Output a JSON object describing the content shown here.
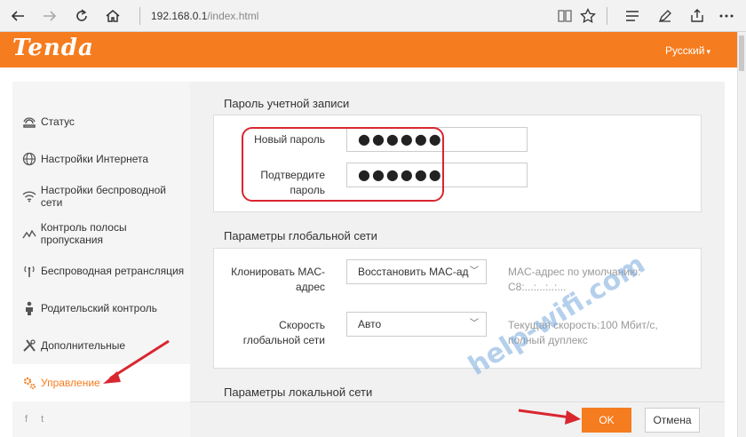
{
  "browser": {
    "address_host": "192.168.0.1",
    "address_path": "/index.html"
  },
  "header": {
    "logo": "Tenda",
    "language": "Русский"
  },
  "sidebar": {
    "items": [
      {
        "label": "Статус",
        "icon": "status-icon"
      },
      {
        "label": "Настройки Интернета",
        "icon": "globe-icon"
      },
      {
        "label": "Настройки беспроводной сети",
        "icon": "wifi-icon"
      },
      {
        "label": "Контроль полосы пропускания",
        "icon": "bandwidth-icon"
      },
      {
        "label": "Беспроводная ретрансляция",
        "icon": "antenna-icon"
      },
      {
        "label": "Родительский контроль",
        "icon": "parent-icon"
      },
      {
        "label": "Дополнительные",
        "icon": "tools-icon"
      },
      {
        "label": "Управление",
        "icon": "gears-icon",
        "active": true
      }
    ],
    "social": "f  t"
  },
  "account_password": {
    "title": "Пароль учетной записи",
    "new_password_label": "Новый пароль",
    "new_password_value": "●●●●●●",
    "confirm_label_line1": "Подтвердите",
    "confirm_label_line2": "пароль",
    "confirm_value": "●●●●●●"
  },
  "wan": {
    "title": "Параметры глобальной сети",
    "clone_label_line1": "Клонировать MAC-",
    "clone_label_line2": "адрес",
    "clone_value": "Восстановить MAC-ад",
    "clone_hint_line1": "MAC-адрес по умолчанию:",
    "clone_hint_line2": "C8:...:...:..:...",
    "speed_label_line1": "Скорость",
    "speed_label_line2": "глобальной сети",
    "speed_value": "Авто",
    "speed_hint_line1": "Текущая скорость:100 Мбит/с,",
    "speed_hint_line2": "полный дуплекс"
  },
  "lan": {
    "title": "Параметры локальной сети"
  },
  "buttons": {
    "ok": "OK",
    "cancel": "Отмена"
  },
  "watermark": "help-wifi.com",
  "colors": {
    "brand": "#f57c1f",
    "highlight": "#d9262f"
  }
}
